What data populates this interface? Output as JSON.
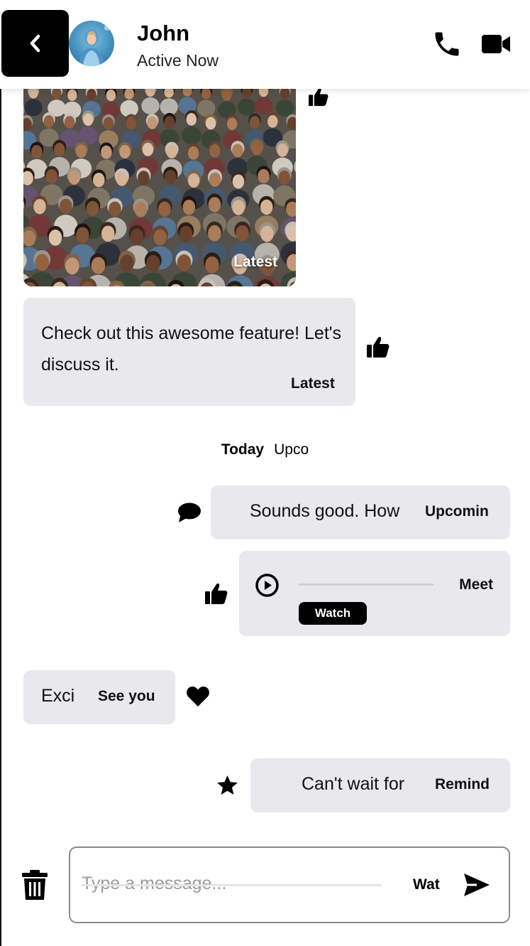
{
  "header": {
    "back_icon": "chevron-left-icon",
    "name": "John",
    "status": "Active Now",
    "call_icon": "phone-icon",
    "video_icon": "video-camera-icon"
  },
  "messages": [
    {
      "type": "image",
      "caption": "Latest",
      "reaction": "thumbs-up-icon",
      "description": "large crowd of people"
    },
    {
      "type": "text",
      "text": "Check out this awesome feature! Let's discuss it.",
      "tag": "Latest",
      "reaction": "thumbs-up-icon"
    },
    {
      "type": "text",
      "text": "Sounds good. How",
      "tag": "Upcomin",
      "reaction": "speech-bubble-icon"
    },
    {
      "type": "audio",
      "button": "Watch",
      "tag": "Meet",
      "reaction": "thumbs-up-icon"
    },
    {
      "type": "text",
      "text": "Exci",
      "tag": "See you",
      "reaction": "heart-icon"
    },
    {
      "type": "text",
      "text": "Can't wait for",
      "tag": "Remind",
      "reaction": "star-icon"
    }
  ],
  "date_separator": {
    "label": "Today",
    "extra": "Upco"
  },
  "composer": {
    "placeholder": "Type a message...",
    "value": "",
    "tag": "Wat",
    "send_icon": "send-icon",
    "delete_icon": "trash-icon"
  },
  "colors": {
    "bubble_bg": "#e8e8ed",
    "header_bg": "#ffffff",
    "accent": "#000000"
  }
}
